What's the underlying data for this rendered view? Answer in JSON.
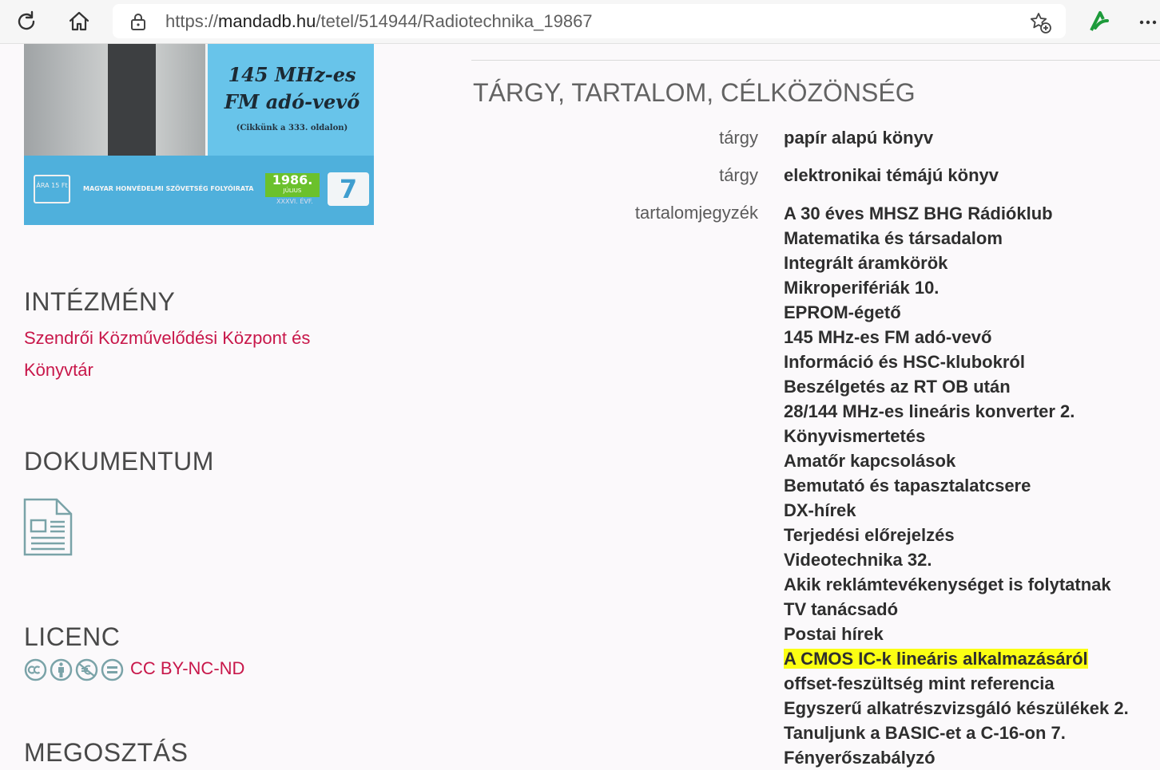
{
  "browser": {
    "url_scheme": "https://",
    "url_domain": "mandadb.hu",
    "url_path": "/tetel/514944/Radiotechnika_19867"
  },
  "cover": {
    "headline": "145 MHz-es FM adó-vevő",
    "caption": "(Cikkünk a 333. oldalon)",
    "price": "ÁRA 15 Ft",
    "publisher": "MAGYAR HONVÉDELMI SZÖVETSÉG FOLYÓIRATA",
    "year": "1986.",
    "month": "JÚLIUS",
    "volume": "XXXVI. ÉVF.",
    "issue": "7"
  },
  "left": {
    "institution_title": "INTÉZMÉNY",
    "institution_link": "Szendrői Közművelődési Központ és Könyvtár",
    "document_title": "DOKUMENTUM",
    "license_title": "LICENC",
    "license_link": "CC BY-NC-ND",
    "next_title": "MEGOSZTÁS"
  },
  "right": {
    "section_title": "TÁRGY, TARTALOM, CÉLKÖZÖNSÉG",
    "subject_label": "tárgy",
    "subject_1": "papír alapú könyv",
    "subject_2": "elektronikai témájú könyv",
    "toc_label": "tartalomjegyzék",
    "toc_items": [
      "A 30 éves MHSZ BHG Rádióklub",
      "Matematika és társadalom",
      "Integrált áramkörök",
      "Mikroperifériák 10.",
      "EPROM-égető",
      "145 MHz-es FM adó-vevő",
      "Információ és HSC-klubokról",
      "Beszélgetés az RT OB után",
      "28/144 MHz-es lineáris konverter 2.",
      "Könyvismertetés",
      "Amatőr kapcsolások",
      "Bemutató és tapasztalatcsere",
      "DX-hírek",
      "Terjedési előrejelzés",
      "Videotechnika 32.",
      "Akik reklámtevékenységet is folytatnak",
      "TV tanácsadó",
      "Postai hírek",
      "A CMOS IC-k lineáris alkalmazásáról",
      "offset-feszültség mint referencia",
      "Egyszerű alkatrészvizsgáló készülékek 2.",
      "Tanuljunk a BASIC-et a C-16-on 7.",
      "Fényerőszabályzó"
    ],
    "highlighted_index": 18,
    "highlight_color": "#fbff13"
  },
  "colors": {
    "link": "#c8174a",
    "icon": "#7aa3a8"
  }
}
